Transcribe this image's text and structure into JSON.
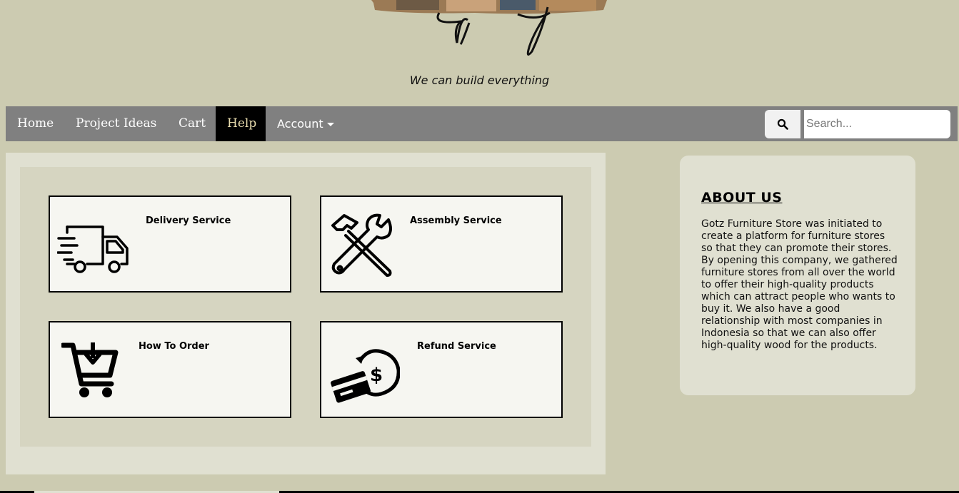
{
  "header": {
    "tagline": "We can build everything"
  },
  "nav": {
    "items": [
      {
        "label": "Home"
      },
      {
        "label": "Project Ideas"
      },
      {
        "label": "Cart"
      },
      {
        "label": "Help"
      },
      {
        "label": "Account"
      }
    ],
    "active": "Help",
    "search": {
      "placeholder": "Search...",
      "icon": "search-icon"
    }
  },
  "services": [
    {
      "title": "Delivery Service",
      "icon": "delivery-truck-icon"
    },
    {
      "title": "Assembly Service",
      "icon": "hammer-wrench-icon"
    },
    {
      "title": "How To Order",
      "icon": "shopping-cart-icon"
    },
    {
      "title": "Refund Service",
      "icon": "refund-card-icon"
    }
  ],
  "about": {
    "title": "ABOUT US",
    "text": "Gotz Furniture Store was initiated to create a platform for furniture stores so that they can promote their stores. By opening this company, we gathered furniture stores from all over the world to offer their high-quality products which can attract people who wants to buy it. We also have a good relationship with most companies in Indonesia so that we can also offer high-quality wood for the products."
  },
  "colors": {
    "background": "#cccbb1",
    "navbar": "#808080",
    "active_nav": "#000000",
    "active_nav_text": "#e8dcae",
    "panel": "#e0e0d1",
    "inner_panel": "#d6d5c1",
    "card": "#f6f6f1"
  }
}
